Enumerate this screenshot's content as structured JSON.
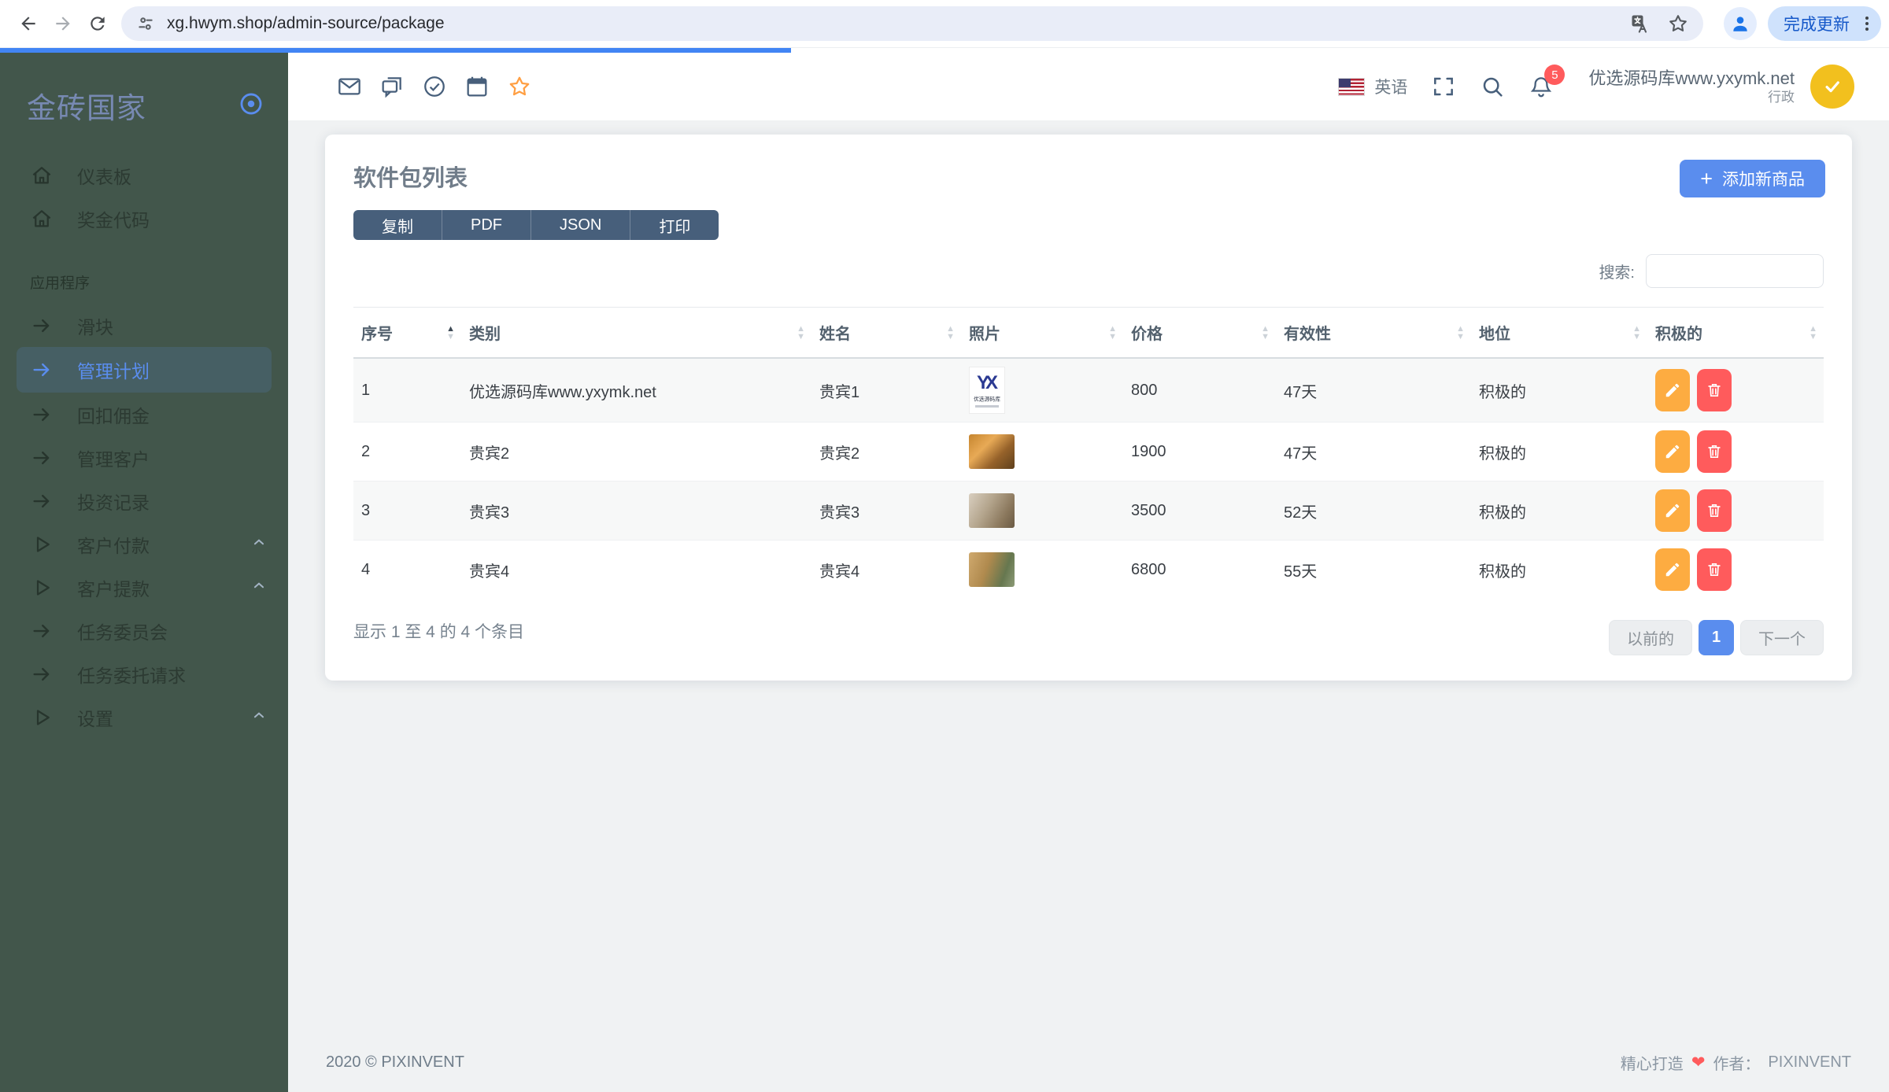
{
  "browser": {
    "url": "xg.hwym.shop/admin-source/package",
    "update_button": "完成更新"
  },
  "sidebar": {
    "logo": "金砖国家",
    "section_label": "应用程序",
    "items_top": [
      {
        "label": "仪表板",
        "icon": "home"
      },
      {
        "label": "奖金代码",
        "icon": "home"
      }
    ],
    "items_apps": [
      {
        "label": "滑块",
        "icon": "arrow"
      },
      {
        "label": "管理计划",
        "icon": "arrow",
        "active": true
      },
      {
        "label": "回扣佣金",
        "icon": "arrow"
      },
      {
        "label": "管理客户",
        "icon": "arrow"
      },
      {
        "label": "投资记录",
        "icon": "arrow"
      },
      {
        "label": "客户付款",
        "icon": "play",
        "chevron": true
      },
      {
        "label": "客户提款",
        "icon": "play",
        "chevron": true
      },
      {
        "label": "任务委员会",
        "icon": "arrow"
      },
      {
        "label": "任务委托请求",
        "icon": "arrow"
      },
      {
        "label": "设置",
        "icon": "play",
        "chevron": true
      }
    ]
  },
  "header": {
    "language": "英语",
    "notification_count": "5",
    "user_name": "优选源码库www.yxymk.net",
    "user_role": "行政"
  },
  "card": {
    "title": "软件包列表",
    "export_buttons": [
      "复制",
      "PDF",
      "JSON",
      "打印"
    ],
    "add_button": "添加新商品",
    "search_label": "搜索:"
  },
  "table": {
    "headers": [
      {
        "label": "序号",
        "sort": "asc"
      },
      {
        "label": "类别"
      },
      {
        "label": "姓名"
      },
      {
        "label": "照片"
      },
      {
        "label": "价格"
      },
      {
        "label": "有效性"
      },
      {
        "label": "地位"
      },
      {
        "label": "积极的"
      }
    ],
    "logo_monogram": "YX",
    "logo_caption": "优选源码库",
    "rows": [
      {
        "no": "1",
        "category": "优选源码库www.yxymk.net",
        "name": "贵宾1",
        "photo": "yx-logo",
        "price": "800",
        "validity": "47天",
        "status": "积极的"
      },
      {
        "no": "2",
        "category": "贵宾2",
        "name": "贵宾2",
        "photo": "warehouse-shelves",
        "price": "1900",
        "validity": "47天",
        "status": "积极的"
      },
      {
        "no": "3",
        "category": "贵宾3",
        "name": "贵宾3",
        "photo": "warehouse-interior",
        "price": "3500",
        "validity": "52天",
        "status": "积极的"
      },
      {
        "no": "4",
        "category": "贵宾4",
        "name": "贵宾4",
        "photo": "warehouse-boxes",
        "price": "6800",
        "validity": "55天",
        "status": "积极的"
      }
    ],
    "info": "显示 1 至 4 的 4 个条目",
    "pagination": {
      "prev": "以前的",
      "page": "1",
      "next": "下一个"
    }
  },
  "footer": {
    "left": "2020 © PIXINVENT",
    "right_prefix": "精心打造",
    "author_label": "作者：",
    "author": "PIXINVENT"
  },
  "colors": {
    "accent_blue": "#5a8dee",
    "dark_slate": "#475f7b",
    "warning_orange": "#fdac41",
    "danger_red": "#ff5b5c",
    "star_orange": "#ff9f43",
    "sidebar_green": "#42564b",
    "progress_blue": "#4285f4"
  }
}
